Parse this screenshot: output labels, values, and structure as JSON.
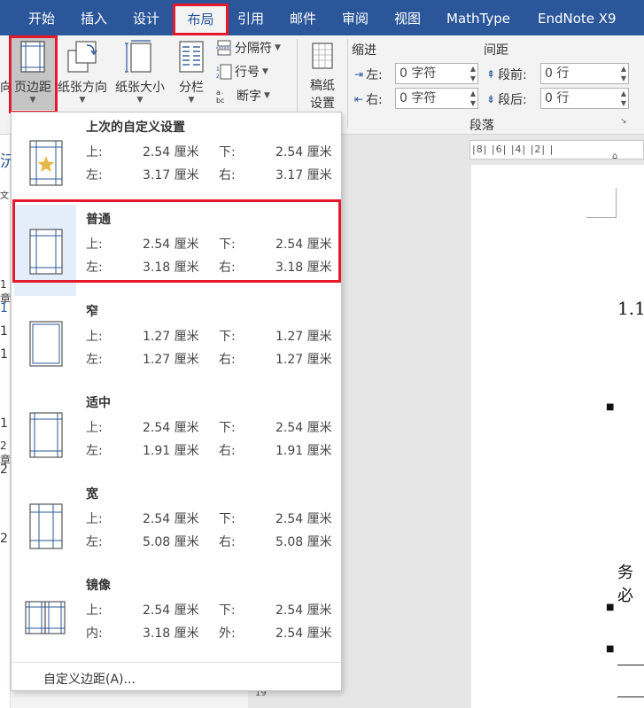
{
  "tabs": [
    "开始",
    "插入",
    "设计",
    "布局",
    "引用",
    "邮件",
    "审阅",
    "视图",
    "MathType",
    "EndNote X9"
  ],
  "active_tab": "布局",
  "ribbon": {
    "left_cut_label": "向",
    "margins_label": "页边距",
    "orientation_label": "纸张方向",
    "size_label": "纸张大小",
    "columns_label": "分栏",
    "breaks_label": "分隔符",
    "line_numbers_label": "行号",
    "hyphenation_label": "断字",
    "draft_label_1": "稿纸",
    "draft_label_2": "设置",
    "indent_header": "缩进",
    "spacing_header": "间距",
    "indent_left_label": "左:",
    "indent_left_value": "0 字符",
    "indent_right_label": "右:",
    "indent_right_value": "0 字符",
    "spacing_before_label": "段前:",
    "spacing_before_value": "0 行",
    "spacing_after_label": "段后:",
    "spacing_after_value": "0 行",
    "paragraph_group_label": "段落"
  },
  "left_strip": {
    "chars": [
      "沅",
      "文",
      "1章",
      "1",
      "1",
      "1",
      "1",
      "2章",
      "2",
      "2"
    ]
  },
  "ruler": {
    "text": "|8|  |6|  |4|  |2|  |",
    "vruler_num": "19"
  },
  "document": {
    "heading": "1.1",
    "bullets": [
      "■",
      "■",
      "■"
    ],
    "text_fragment": "务必"
  },
  "dropdown": {
    "options": [
      {
        "name": "上次的自定义设置",
        "icon": "star-margin-icon",
        "r1": [
          "上:",
          "2.54 厘米",
          "下:",
          "2.54 厘米"
        ],
        "r2": [
          "左:",
          "3.17 厘米",
          "右:",
          "3.17 厘米"
        ]
      },
      {
        "name": "普通",
        "icon": "normal-margin-icon",
        "r1": [
          "上:",
          "2.54 厘米",
          "下:",
          "2.54 厘米"
        ],
        "r2": [
          "左:",
          "3.18 厘米",
          "右:",
          "3.18 厘米"
        ]
      },
      {
        "name": "窄",
        "icon": "narrow-margin-icon",
        "r1": [
          "上:",
          "1.27 厘米",
          "下:",
          "1.27 厘米"
        ],
        "r2": [
          "左:",
          "1.27 厘米",
          "右:",
          "1.27 厘米"
        ]
      },
      {
        "name": "适中",
        "icon": "moderate-margin-icon",
        "r1": [
          "上:",
          "2.54 厘米",
          "下:",
          "2.54 厘米"
        ],
        "r2": [
          "左:",
          "1.91 厘米",
          "右:",
          "1.91 厘米"
        ]
      },
      {
        "name": "宽",
        "icon": "wide-margin-icon",
        "r1": [
          "上:",
          "2.54 厘米",
          "下:",
          "2.54 厘米"
        ],
        "r2": [
          "左:",
          "5.08 厘米",
          "右:",
          "5.08 厘米"
        ]
      },
      {
        "name": "镜像",
        "icon": "mirrored-margin-icon",
        "r1": [
          "上:",
          "2.54 厘米",
          "下:",
          "2.54 厘米"
        ],
        "r2": [
          "内:",
          "3.18 厘米",
          "外:",
          "2.54 厘米"
        ]
      }
    ],
    "footer": "自定义边距(A)..."
  },
  "colors": {
    "ribbon_blue": "#2b579a",
    "highlight_red": "#e5192c",
    "icon_blue": "#2b579a"
  }
}
